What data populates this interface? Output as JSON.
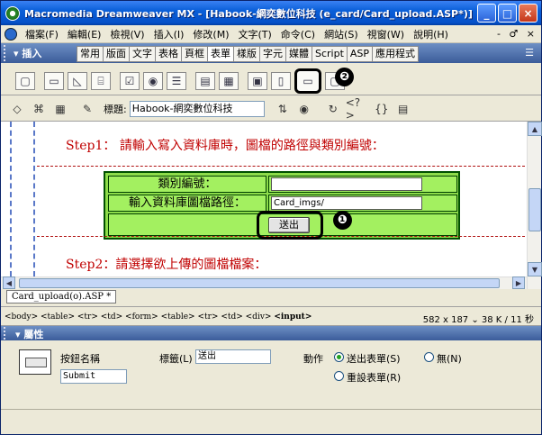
{
  "window": {
    "title": "Macromedia Dreamweaver MX - [Habook-網奕數位科技 (e_card/Card_upload.ASP*)]",
    "controls": [
      "_",
      "□",
      "×"
    ]
  },
  "menubar": {
    "items": [
      "檔案(F)",
      "編輯(E)",
      "檢視(V)",
      "插入(I)",
      "修改(M)",
      "文字(T)",
      "命令(C)",
      "網站(S)",
      "視窗(W)",
      "說明(H)"
    ],
    "right_controls": "- ♂ ×"
  },
  "insert_panel": {
    "title": "插入",
    "tabs": [
      "常用",
      "版面",
      "文字",
      "表格",
      "頁框",
      "表單",
      "樣版",
      "字元",
      "媒體",
      "Script",
      "ASP",
      "應用程式"
    ],
    "active_tab": "表單",
    "icons": [
      "form-icon",
      "textfield-icon",
      "hidden-field-icon",
      "textarea-icon",
      "checkbox-icon",
      "radio-icon",
      "radio-group-icon",
      "list-menu-icon",
      "jump-menu-icon",
      "image-field-icon",
      "file-field-icon",
      "button-icon",
      "label-icon"
    ],
    "icon_glyphs": [
      "▢",
      "▭",
      "◺",
      "⌸",
      "☑",
      "◉",
      "☰",
      "▤",
      "▦",
      "▣",
      "▯",
      "▭",
      "▢"
    ],
    "badge_2": "❷"
  },
  "document_toolbar": {
    "buttons": [
      "code-view-icon",
      "split-view-icon",
      "design-view-icon",
      "live-data-icon"
    ],
    "button_glyphs": [
      "◇",
      "⌘",
      "▦",
      "✎"
    ],
    "title_label": "標題:",
    "title_value": "Habook-網奕數位科技",
    "tool_glyphs": [
      "⇅",
      "◉",
      "↻",
      "<?>",
      "{}",
      "▤"
    ]
  },
  "document": {
    "step1": "Step1： 請輸入寫入資料庫時，圖檔的路徑與類別編號：",
    "row1_label": "類別編號：",
    "row1_value": "",
    "row2_label": "輸入資料庫圖檔路徑：",
    "row2_value": "Card_imgs/",
    "submit_label": "送出",
    "badge_1": "❶",
    "step2": "Step2：請選擇欲上傳的圖檔檔案："
  },
  "doc_tab": "Card_upload(o).ASP *",
  "status": {
    "tag_path": "<body> <table> <tr> <td> <form> <table> <tr> <td> <div>",
    "tag_selected": "<input>",
    "size_info": "582 x 187 ⌄ 38 K / 11 秒"
  },
  "properties": {
    "title": "屬性",
    "button_name_label": "按鈕名稱",
    "button_name_value": "Submit",
    "label_label": "標籤(L)",
    "label_value": "送出",
    "action_label": "動作",
    "action_submit": "送出表單(S)",
    "action_none": "無(N)",
    "action_reset": "重設表單(R)"
  }
}
